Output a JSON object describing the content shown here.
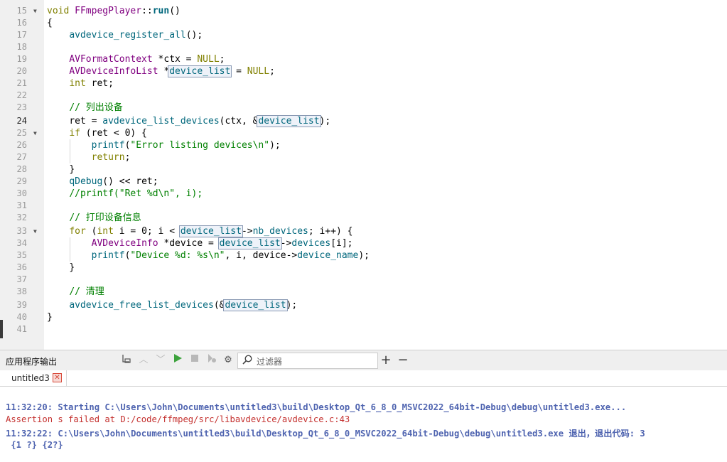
{
  "editor": {
    "line_numbers": [
      "15",
      "16",
      "17",
      "18",
      "19",
      "20",
      "21",
      "22",
      "23",
      "24",
      "25",
      "26",
      "27",
      "28",
      "29",
      "30",
      "31",
      "32",
      "33",
      "34",
      "35",
      "36",
      "37",
      "38",
      "39",
      "40",
      "41"
    ],
    "current_line": "24",
    "code": {
      "l15": {
        "kw": "void",
        "cls": "FFmpegPlayer",
        "sep": "::",
        "fn": "run",
        "rest": "()"
      },
      "l16": "{",
      "l17": {
        "fn": "avdevice_register_all",
        "rest": "();"
      },
      "l19": {
        "ty": "AVFormatContext",
        "a": " *ctx = ",
        "kw": "NULL",
        "b": ";"
      },
      "l20": {
        "ty": "AVDeviceInfoList",
        "a": " *",
        "hl": "device_list",
        "b": " = ",
        "kw": "NULL",
        "c": ";"
      },
      "l21": {
        "kw": "int",
        "rest": " ret;"
      },
      "l23": "// 列出设备",
      "l24": {
        "a": "ret = ",
        "fn": "avdevice_list_devices",
        "b": "(ctx, &",
        "hl": "device_list",
        "c": ");"
      },
      "l25": {
        "kw": "if",
        "rest": " (ret < 0) {"
      },
      "l26": {
        "fn": "printf",
        "a": "(",
        "str": "\"Error listing devices\\n\"",
        "b": ");"
      },
      "l27": {
        "kw": "return",
        "rest": ";"
      },
      "l28": "}",
      "l29": {
        "fn": "qDebug",
        "rest": "() << ret;"
      },
      "l30": "//printf(\"Ret %d\\n\", i);",
      "l32": "// 打印设备信息",
      "l33": {
        "kw": "for",
        "a": " (",
        "kw2": "int",
        "b": " i = 0; i < ",
        "hl": "device_list",
        "c": "->",
        "mem": "nb_devices",
        "d": "; i++) {"
      },
      "l34": {
        "ty": "AVDeviceInfo",
        "a": " *device = ",
        "hl": "device_list",
        "b": "->",
        "mem": "devices",
        "c": "[i];"
      },
      "l35": {
        "fn": "printf",
        "a": "(",
        "str": "\"Device %d: %s\\n\"",
        "b": ", i, device->",
        "mem": "device_name",
        "c": ");"
      },
      "l36": "}",
      "l38": "// 清理",
      "l39": {
        "fn": "avdevice_free_list_devices",
        "a": "(&",
        "hl": "device_list",
        "b": ");"
      },
      "l40": "}"
    }
  },
  "output_panel": {
    "title": "应用程序输出",
    "filter_placeholder": "过滤器",
    "tab_label": "untitled3",
    "lines": {
      "starting": "11:32:20: Starting C:\\Users\\John\\Documents\\untitled3\\build\\Desktop_Qt_6_8_0_MSVC2022_64bit-Debug\\debug\\untitled3.exe...",
      "assertion": "Assertion s failed at D:/code/ffmpeg/src/libavdevice/avdevice.c:43",
      "exited": "11:32:22: C:\\Users\\John\\Documents\\untitled3\\build\\Desktop_Qt_6_8_0_MSVC2022_64bit-Debug\\debug\\untitled3.exe 退出，退出代码: 3",
      "tail": " {1 ?} {2?}"
    }
  },
  "colors": {
    "keyword": "#808000",
    "type": "#800080",
    "function": "#00677c",
    "string_comment": "#008000",
    "output_blue": "#4f64b0",
    "output_red": "#c4302e"
  }
}
